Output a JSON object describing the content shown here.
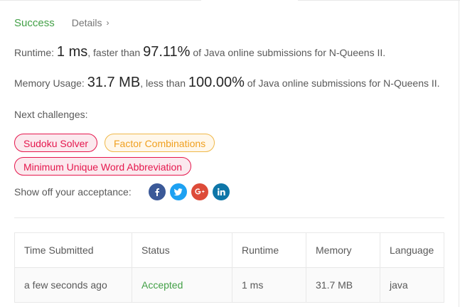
{
  "result": {
    "status": "Success",
    "details_label": "Details",
    "runtime_label": "Runtime: ",
    "runtime_value": "1 ms",
    "runtime_mid": ", faster than ",
    "runtime_percent": "97.11%",
    "runtime_suffix": " of Java online submissions for N-Queens II.",
    "memory_label": "Memory Usage: ",
    "memory_value": "31.7 MB",
    "memory_mid": ", less than ",
    "memory_percent": "100.00%",
    "memory_suffix": " of Java online submissions for N-Queens II."
  },
  "next_challenges": {
    "label": "Next challenges:",
    "items": [
      {
        "label": "Sudoku Solver",
        "difficulty": "hard"
      },
      {
        "label": "Factor Combinations",
        "difficulty": "medium"
      },
      {
        "label": "Minimum Unique Word Abbreviation",
        "difficulty": "hard"
      }
    ]
  },
  "share": {
    "label": "Show off your acceptance:",
    "icons": [
      "facebook-icon",
      "twitter-icon",
      "google-plus-icon",
      "linkedin-icon"
    ]
  },
  "table": {
    "headers": [
      "Time Submitted",
      "Status",
      "Runtime",
      "Memory",
      "Language"
    ],
    "rows": [
      [
        "a few seconds ago",
        "Accepted",
        "1 ms",
        "31.7 MB",
        "java"
      ]
    ]
  },
  "colors": {
    "success": "#43a047",
    "hard": "#e5174d",
    "medium": "#f0a020"
  }
}
